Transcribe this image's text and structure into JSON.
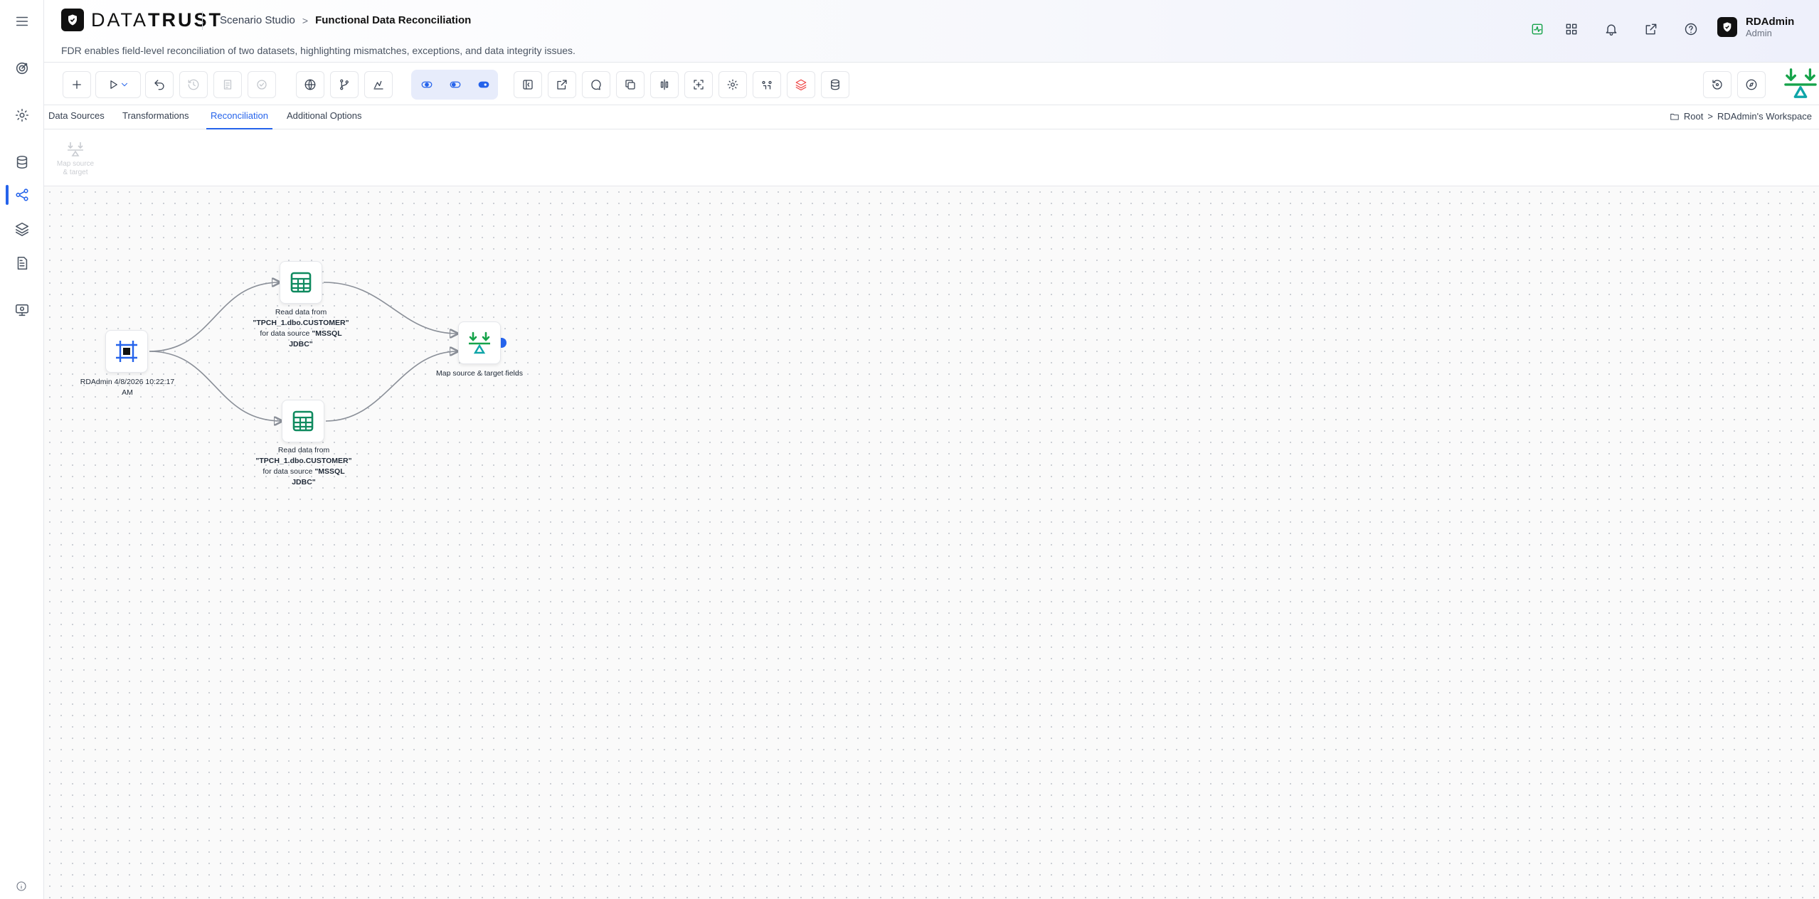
{
  "brand": {
    "name_light": "DATA",
    "name_bold": "TRUST"
  },
  "breadcrumb": {
    "parent": "Scenario Studio",
    "separator": ">",
    "current": "Functional Data Reconciliation"
  },
  "subtitle": "FDR enables field-level reconciliation of two datasets, highlighting mismatches, exceptions, and data integrity issues.",
  "user": {
    "name": "RDAdmin",
    "role": "Admin"
  },
  "header_icons": [
    "activity-icon",
    "grid-icon",
    "bell-icon",
    "external-link-icon",
    "help-icon"
  ],
  "colors": {
    "accent": "#2563eb",
    "node_green": "#0f8a5f",
    "brand_green": "#16a34a",
    "brand_teal": "#0ea5a8",
    "danger": "#ef4444"
  },
  "tabs": [
    {
      "label": "Data Sources",
      "active": false
    },
    {
      "label": "Transformations",
      "active": false
    },
    {
      "label": "Reconciliation",
      "active": true
    },
    {
      "label": "Additional Options",
      "active": false
    }
  ],
  "workspace": {
    "root": "Root",
    "separator": ">",
    "name": "RDAdmin's Workspace"
  },
  "palette": {
    "item_label": "Map source & target"
  },
  "nodes": {
    "start": {
      "label": "RDAdmin 4/8/2026 10:22:17 AM"
    },
    "read_1": {
      "prefix": "Read data from ",
      "table": "\"TPCH_1.dbo.CUSTOMER\"",
      "middle": " for data source ",
      "source": "\"MSSQL JDBC\""
    },
    "read_2": {
      "prefix": "Read data from ",
      "table": "\"TPCH_1.dbo.CUSTOMER\"",
      "middle": " for data source ",
      "source": "\"MSSQL JDBC\""
    },
    "map": {
      "label": "Map source & target fields"
    }
  }
}
